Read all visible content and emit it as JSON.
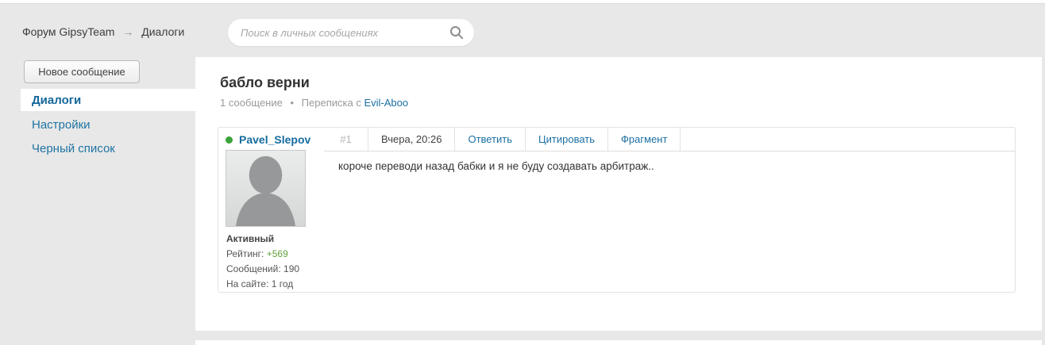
{
  "header": {
    "breadcrumb": {
      "root": "Форум GipsyTeam",
      "arrow": "→",
      "current": "Диалоги"
    },
    "search": {
      "placeholder": "Поиск в личных сообщениях",
      "icon": "magnifier"
    }
  },
  "sidebar": {
    "new_message_button": "Новое сообщение",
    "items": [
      {
        "label": "Диалоги",
        "active": true
      },
      {
        "label": "Настройки",
        "active": false
      },
      {
        "label": "Черный список",
        "active": false
      }
    ]
  },
  "thread": {
    "title": "бабло верни",
    "meta": {
      "count": "1 сообщение",
      "bullet": "•",
      "with_label": "Переписка с",
      "peer": "Evil-Aboo"
    }
  },
  "message": {
    "author": "Pavel_Slepov",
    "online": true,
    "number": "#1",
    "timestamp": "Вчера, 20:26",
    "actions": [
      "Ответить",
      "Цитировать",
      "Фрагмент"
    ],
    "author_stats": {
      "status": "Активный",
      "rating_label": "Рейтинг:",
      "rating_value": "+569",
      "posts_label": "Сообщений:",
      "posts_value": "190",
      "onsite_label": "На сайте:",
      "onsite_value": "1 год"
    },
    "body": "короче переводи назад бабки и я не буду создавать арбитраж.."
  },
  "colors": {
    "page_bg": "#e8e8e8",
    "panel_bg": "#ffffff",
    "link_blue": "#1b6fa3",
    "active_item_blue": "#14679c",
    "online_green": "#3aa23a",
    "rating_green": "#61a13e",
    "muted_gray": "#999999",
    "text_dark": "#333333"
  }
}
